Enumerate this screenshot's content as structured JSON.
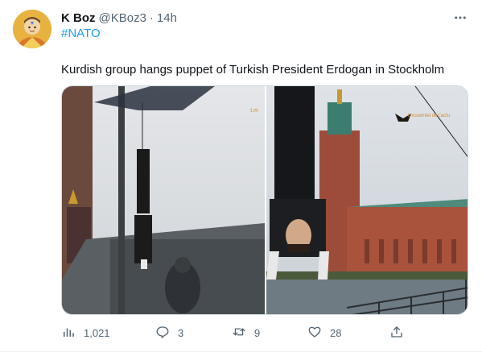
{
  "tweet": {
    "display_name": "K Boz",
    "handle": "@KBoz3",
    "separator": "·",
    "time": "14h",
    "hashtag": "#NATO",
    "text": "Kurdish group hangs puppet of Turkish President Erdogan in Stockholm",
    "media": {
      "watermark_right": "L'essentiel de l'actu"
    }
  },
  "actions": {
    "views": "1,021",
    "replies": "3",
    "retweets": "9",
    "likes": "28"
  },
  "icons": {
    "more": "more-dots-icon",
    "views": "views-bar-chart-icon",
    "reply": "reply-bubble-icon",
    "retweet": "retweet-icon",
    "like": "heart-icon",
    "share": "share-upload-icon"
  },
  "colors": {
    "link": "#1d9bf0",
    "secondary": "#536471",
    "text": "#0f1419"
  }
}
